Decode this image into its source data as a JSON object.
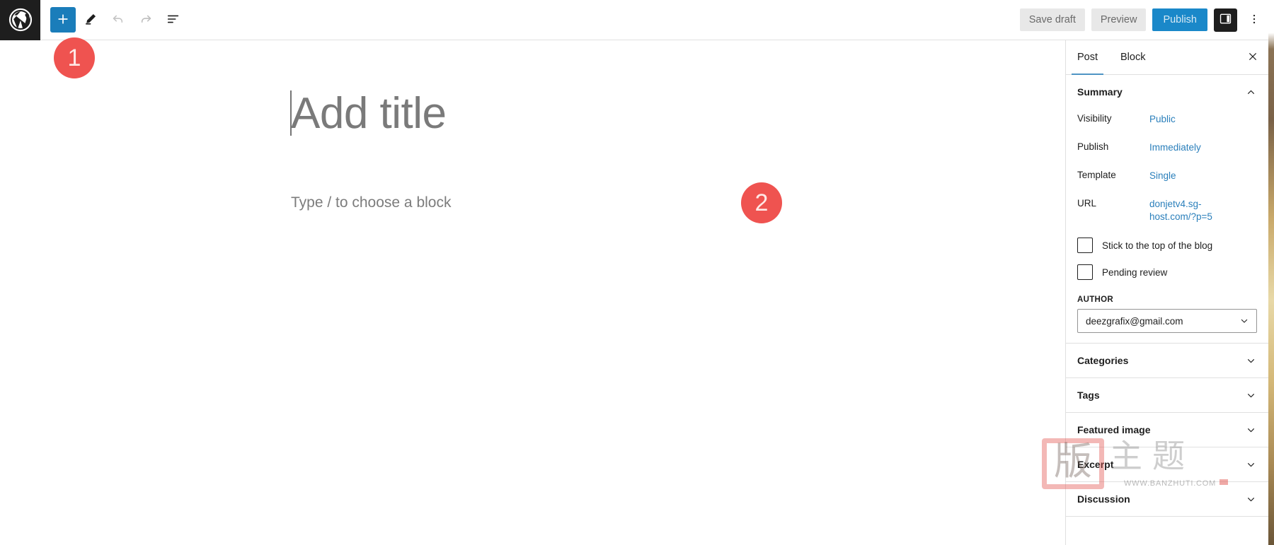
{
  "app": {
    "name": "WordPress Block Editor",
    "logo_icon": "wordpress-logo-icon"
  },
  "header": {
    "toolbar_left": [
      {
        "name": "block-inserter-toggle",
        "icon": "plus-icon",
        "label": "Toggle block inserter",
        "state": "active"
      },
      {
        "name": "tools-toggle",
        "icon": "pencil-icon",
        "label": "Tools",
        "state": "default"
      },
      {
        "name": "undo-button",
        "icon": "undo-arrow-icon",
        "label": "Undo",
        "state": "disabled"
      },
      {
        "name": "redo-button",
        "icon": "redo-arrow-icon",
        "label": "Redo",
        "state": "disabled"
      },
      {
        "name": "list-view-toggle",
        "icon": "list-view-icon",
        "label": "Document Overview",
        "state": "default"
      }
    ],
    "save_draft_label": "Save draft",
    "preview_label": "Preview",
    "publish_label": "Publish",
    "settings_toggle": {
      "icon": "sidebar-panel-icon",
      "label": "Settings",
      "state": "active"
    },
    "options_menu": {
      "icon": "vertical-ellipsis-icon",
      "label": "Options"
    }
  },
  "editor": {
    "title_placeholder": "Add title",
    "block_placeholder": "Type / to choose a block",
    "inline_appender": {
      "icon": "plus-icon",
      "label": "Add block"
    }
  },
  "annotations": [
    {
      "id": "1",
      "number": "1"
    },
    {
      "id": "2",
      "number": "2"
    }
  ],
  "sidebar": {
    "tabs": [
      {
        "label": "Post",
        "active": true
      },
      {
        "label": "Block",
        "active": false
      }
    ],
    "close_icon": "close-icon",
    "summary": {
      "title": "Summary",
      "chevron": "chevron-up-icon",
      "rows": [
        {
          "label": "Visibility",
          "value": "Public"
        },
        {
          "label": "Publish",
          "value": "Immediately"
        },
        {
          "label": "Template",
          "value": "Single"
        },
        {
          "label": "URL",
          "value": "donjetv4.sg-host.com/?p=5"
        }
      ],
      "checkboxes": [
        {
          "label": "Stick to the top of the blog",
          "checked": false
        },
        {
          "label": "Pending review",
          "checked": false
        }
      ],
      "author_label": "AUTHOR",
      "author_value": "deezgrafix@gmail.com",
      "author_chevron": "chevron-down-icon"
    },
    "panels": [
      {
        "title": "Categories",
        "chevron": "chevron-down-icon"
      },
      {
        "title": "Tags",
        "chevron": "chevron-down-icon"
      },
      {
        "title": "Featured image",
        "chevron": "chevron-down-icon"
      },
      {
        "title": "Excerpt",
        "chevron": "chevron-down-icon"
      },
      {
        "title": "Discussion",
        "chevron": "chevron-down-icon"
      }
    ]
  },
  "watermark": {
    "stamp_glyph": "版",
    "cn_text": "主题",
    "url": "WWW.BANZHUTI.COM"
  },
  "colors": {
    "accent_blue": "#1a88c9",
    "link_blue": "#2a7fbb",
    "marker_red": "#ef5350",
    "dark": "#1e1e1e",
    "border": "#e0e0e0"
  }
}
